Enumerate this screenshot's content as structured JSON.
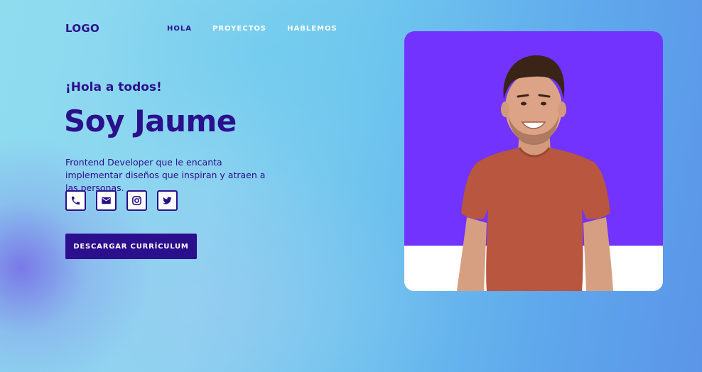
{
  "header": {
    "logo": "LOGO",
    "nav": [
      "HOLA",
      "PROYECTOS",
      "HABLEMOS"
    ]
  },
  "hero": {
    "greeting": "¡Hola a todos!",
    "title": "Soy Jaume",
    "description": "Frontend Developer que le encanta implementar diseños que inspiran y atraen a las personas.",
    "cta_label": "DESCARGAR CURRÍCULUM",
    "socials": [
      "phone-icon",
      "mail-icon",
      "instagram-icon",
      "twitter-icon"
    ]
  },
  "colors": {
    "primary": "#2b0f8c",
    "photo_background": "#7233ff",
    "shirt": "#b85640"
  }
}
